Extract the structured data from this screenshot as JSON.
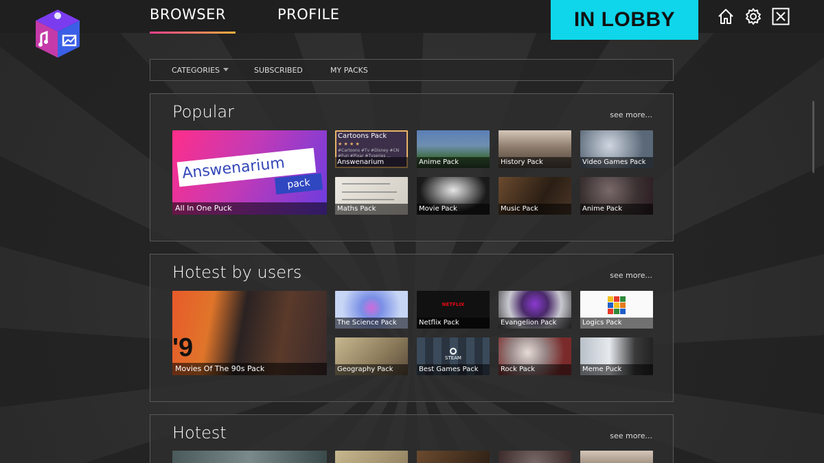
{
  "header": {
    "tabs": [
      {
        "label": "BROWSER"
      },
      {
        "label": "PROFILE"
      }
    ],
    "status": "IN LOBBY",
    "icons": [
      "home-icon",
      "settings-icon",
      "close-icon"
    ],
    "accent": "#0fd6ea"
  },
  "subnav": {
    "categories": "CATEGORIES",
    "subscribed": "SUBSCRIBED",
    "my_packs": "MY PACKS"
  },
  "sections": [
    {
      "title": "Popular",
      "see_more": "see more...",
      "big": {
        "label": "All In One Puck",
        "logo_text": "Answenarium",
        "logo_sub": "pack"
      },
      "cards": [
        {
          "label": "Answenarium",
          "title": "Cartoons Pack",
          "stars": "★ ★ ★ ★",
          "tags": "#Cartoons #Tv #Disney #CN #Fun #Pixar #Tvseries ..."
        },
        {
          "label": "Anime Pack"
        },
        {
          "label": "History Pack"
        },
        {
          "label": "Video Games Pack"
        },
        {
          "label": "Maths Pack"
        },
        {
          "label": "Movie Pack"
        },
        {
          "label": "Music Pack"
        },
        {
          "label": "Anime Pack"
        }
      ]
    },
    {
      "title": "Hotest by users",
      "see_more": "see more...",
      "big": {
        "label": "Movies Of The 90s Pack"
      },
      "cards": [
        {
          "label": "The Science Pack"
        },
        {
          "label": "Netflix Pack",
          "brand": "NETFLIX"
        },
        {
          "label": "Evangelion Pack"
        },
        {
          "label": "Logics Pack"
        },
        {
          "label": "Geography Pack"
        },
        {
          "label": "Best Games Pack",
          "brand": "STEAM"
        },
        {
          "label": "Rock Pack"
        },
        {
          "label": "Meme Puck"
        }
      ]
    },
    {
      "title": "Hotest",
      "see_more": "see more..."
    }
  ]
}
